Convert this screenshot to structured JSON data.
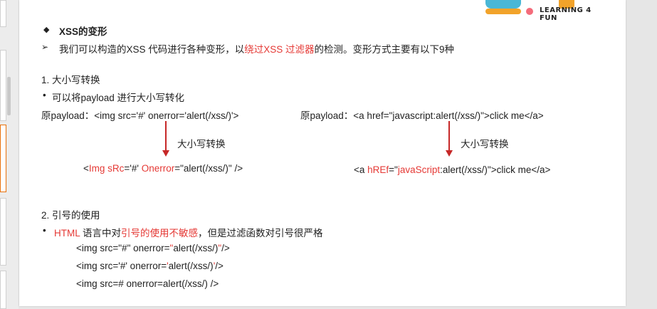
{
  "logo": {
    "tag": "LEARNING 4 FUN"
  },
  "heading": {
    "bullet": "◆",
    "text": "XSS的变形"
  },
  "intro": {
    "bullet": "➢",
    "before": "我们可以构造的XSS 代码进行各种变形，以",
    "red": "绕过XSS 过滤器",
    "after": "的检测。变形方式主要有以下9种"
  },
  "section1": {
    "title": "1.  大小写转换",
    "bullet": "•",
    "sub": "可以将payload 进行大小写转化",
    "left": {
      "original": "原payload：<img src='#' onerror='alert(/xss/)'>",
      "arrow_label": "大小写转换",
      "r1": "<",
      "r2": "Img sRc",
      "r3": "='#' ",
      "r4": "Onerror",
      "r5": "=\"alert(/xss/)\" />"
    },
    "right": {
      "original": "原payload：<a href=\"javascript:alert(/xss/)\">click me</a>",
      "arrow_label": "大小写转换",
      "r1": "<a ",
      "r2": "hREf",
      "r3": "=\"",
      "r4": "javaScript",
      "r5": ":alert(/xss/)\">click me</a>"
    }
  },
  "section2": {
    "title": "2.  引号的使用",
    "bullet": "•",
    "red1": "HTML",
    "mid1": " 语言中对",
    "red2": "引号的使用不敏感",
    "tail": "，但是过滤函数对引号很严格",
    "code1_a": "<img src=\"#\" onerror=",
    "code1_b": "\"",
    "code1_c": "alert(/xss/)",
    "code1_d": "\"",
    "code1_e": "/>",
    "code2_a": "<img src='#' onerror=",
    "code2_b": "'",
    "code2_c": "alert(/xss/)",
    "code2_d": "'",
    "code2_e": "/>",
    "code3": "<img src=# onerror=alert(/xss/) />"
  }
}
